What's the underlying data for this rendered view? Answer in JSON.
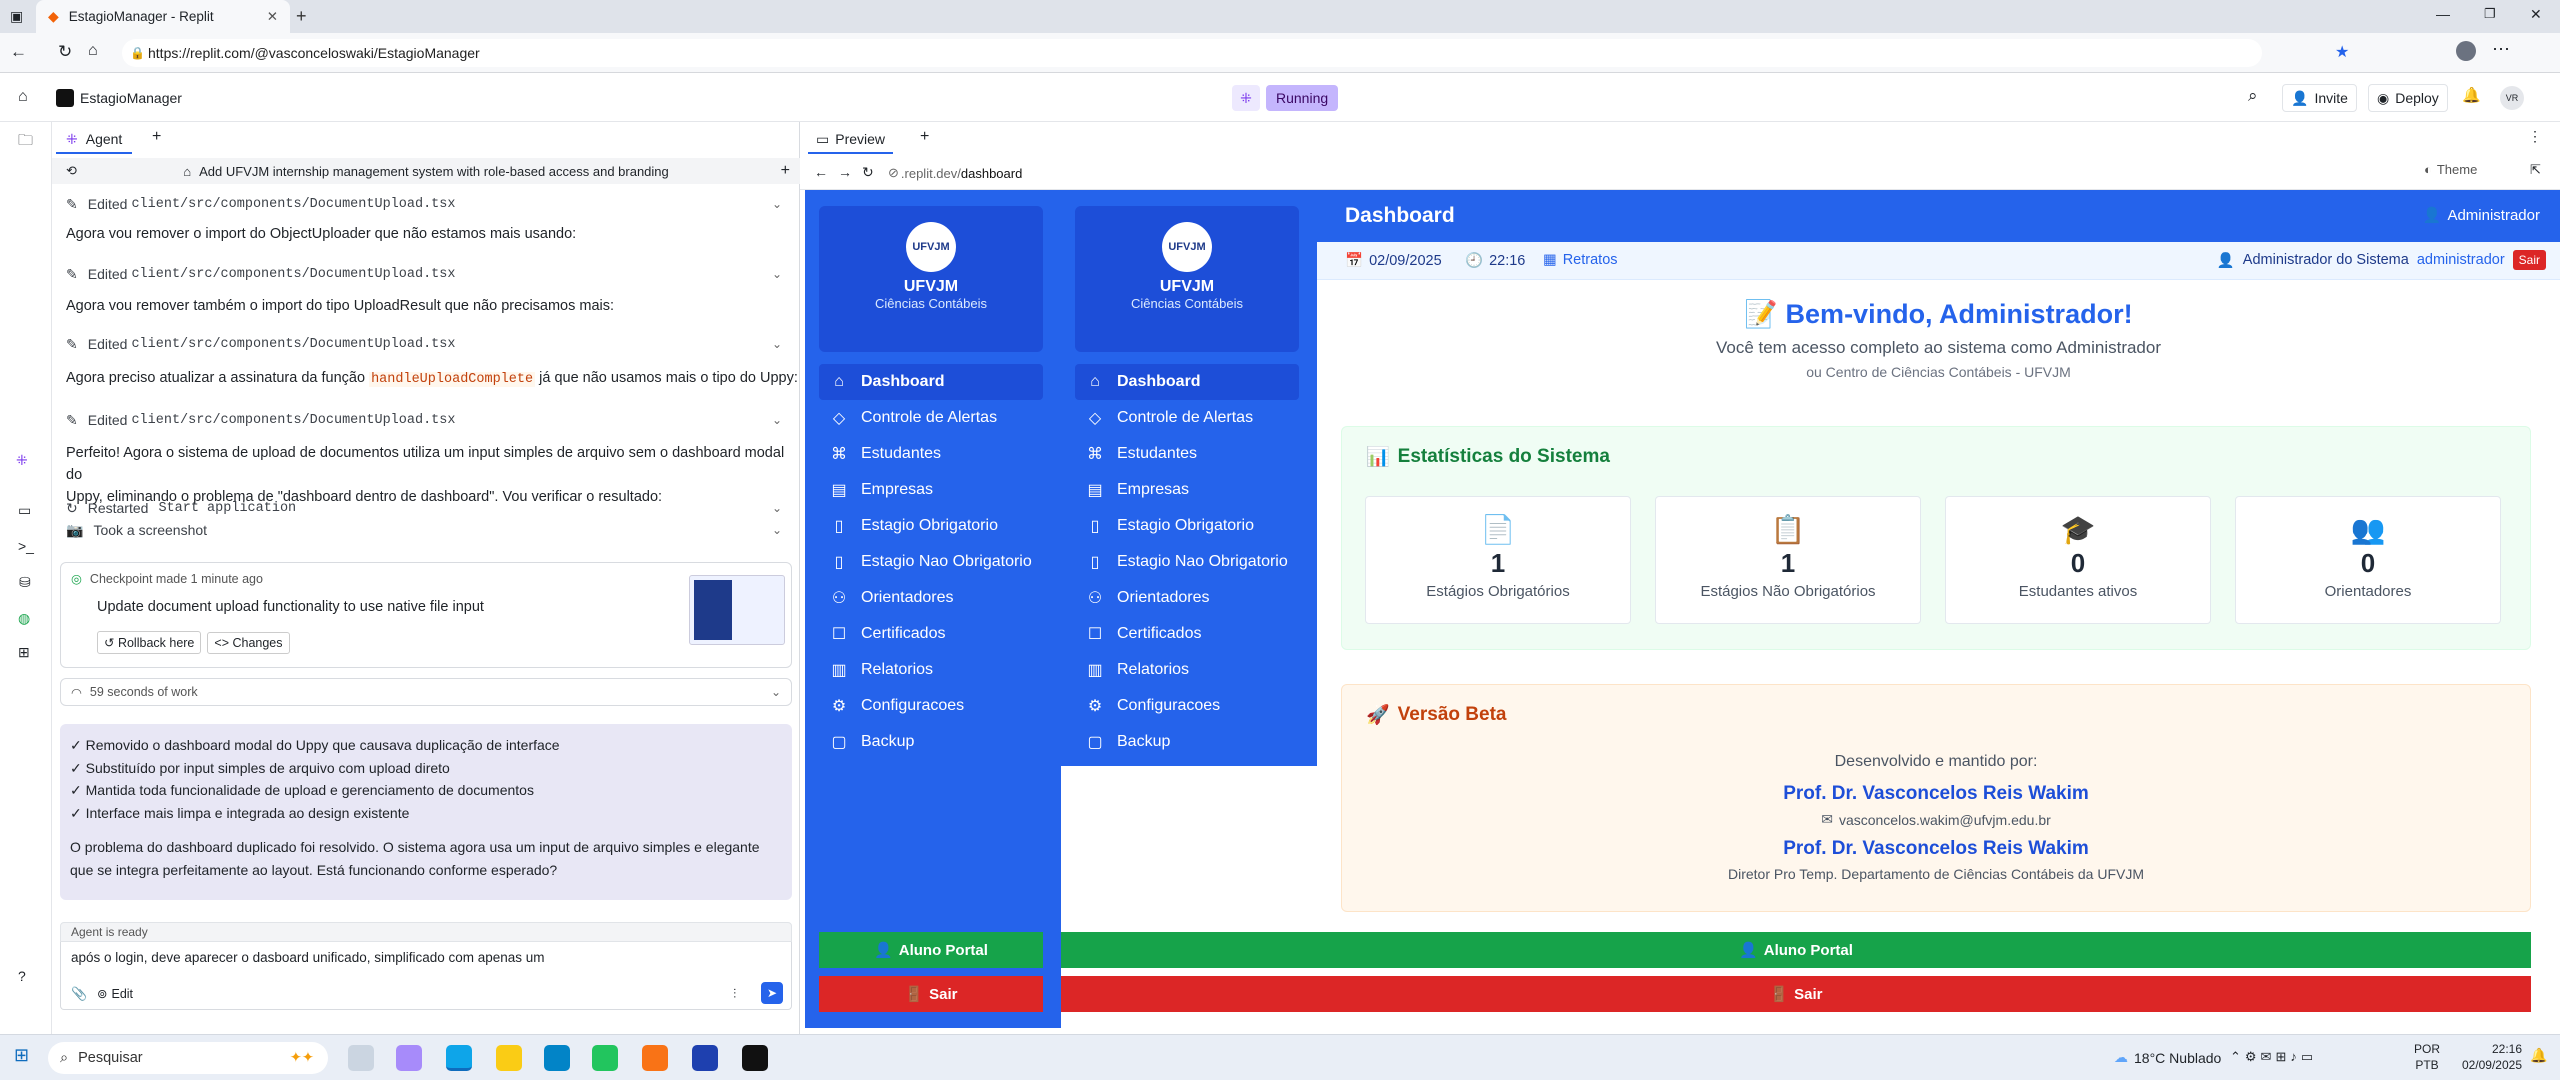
{
  "browser": {
    "tab_title": "EstagioManager - Replit",
    "url": "https://replit.com/@vasconceloswaki/EstagioManager"
  },
  "replit": {
    "project_name": "EstagioManager",
    "status": "Running",
    "invite_label": "Invite",
    "deploy_label": "Deploy",
    "avatar_initials": "VR"
  },
  "agent": {
    "tab_label": "Agent",
    "task_title": "Add UFVJM internship management system with role-based access and branding",
    "entries": [
      {
        "type": "edited",
        "label": "Edited",
        "file": "client/src/components/DocumentUpload.tsx"
      },
      {
        "type": "text",
        "text": "Agora vou remover o import do ObjectUploader que não estamos mais usando:"
      },
      {
        "type": "edited",
        "label": "Edited",
        "file": "client/src/components/DocumentUpload.tsx"
      },
      {
        "type": "text",
        "text": "Agora vou remover também o import do tipo UploadResult que não precisamos mais:"
      },
      {
        "type": "edited",
        "label": "Edited",
        "file": "client/src/components/DocumentUpload.tsx"
      },
      {
        "type": "text_code",
        "before": "Agora preciso atualizar a assinatura da função ",
        "code": "handleUploadComplete",
        "after": " já que não usamos mais o tipo do Uppy:"
      },
      {
        "type": "edited",
        "label": "Edited",
        "file": "client/src/components/DocumentUpload.tsx"
      }
    ],
    "summary_line1": "Perfeito! Agora o sistema de upload de documentos utiliza um input simples de arquivo sem o dashboard modal do",
    "summary_line2": "Uppy, eliminando o problema de \"dashboard dentro de dashboard\". Vou verificar o resultado:",
    "restarted_label": "Restarted",
    "restarted_code": "Start application",
    "screenshot_label": "Took a screenshot",
    "checkpoint_time": "Checkpoint made 1 minute ago",
    "checkpoint_desc": "Update document upload functionality to use native file input",
    "rollback_label": "Rollback here",
    "changes_label": "Changes",
    "work_time": "59 seconds of work",
    "bullets": [
      "✓ Removido o dashboard modal do Uppy que causava duplicação de interface",
      "✓ Substituído por input simples de arquivo com upload direto",
      "✓ Mantida toda funcionalidade de upload e gerenciamento de documentos",
      "✓ Interface mais limpa e integrada ao design existente"
    ],
    "final_line1": "O problema do dashboard duplicado foi resolvido. O sistema agora usa um input de arquivo simples e elegante",
    "final_line2": "que se integra perfeitamente ao layout. Está funcionando conforme esperado?",
    "ready_label": "Agent is ready",
    "input_value": "após o login, deve aparecer o dasboard unificado, simplificado com apenas um",
    "edit_label": "Edit"
  },
  "preview": {
    "tab_label": "Preview",
    "url_host": ".replit.dev/",
    "url_path": "dashboard",
    "theme_label": "Theme"
  },
  "app": {
    "logo_text": "UFVJM",
    "org_name": "UFVJM",
    "org_sub": "Ciências Contábeis",
    "nav": [
      "Dashboard",
      "Controle de Alertas",
      "Estudantes",
      "Empresas",
      "Estagio Obrigatorio",
      "Estagio Nao Obrigatorio",
      "Orientadores",
      "Certificados",
      "Relatorios",
      "Configuracoes",
      "Backup"
    ],
    "header_title": "Dashboard",
    "header_user": "Administrador",
    "date": "02/09/2025",
    "time": "22:16",
    "retratos_label": "Retratos",
    "system_user": "Administrador do Sistema",
    "username": "administrador",
    "logout_label": "Sair",
    "welcome_title": "Bem-vindo, Administrador!",
    "welcome_sub": "Você tem acesso completo ao sistema como Administrador",
    "welcome_sub2": "ou Centro de Ciências Contábeis - UFVJM",
    "stats_title": "Estatísticas do Sistema",
    "stats": [
      {
        "value": "1",
        "label": "Estágios Obrigatórios",
        "icon": "📄"
      },
      {
        "value": "1",
        "label": "Estágios Não Obrigatórios",
        "icon": "📋"
      },
      {
        "value": "0",
        "label": "Estudantes ativos",
        "icon": "🎓"
      },
      {
        "value": "0",
        "label": "Orientadores",
        "icon": "👥"
      }
    ],
    "beta_title": "Versão Beta",
    "beta_dev": "Desenvolvido e mantido por:",
    "beta_name": "Prof. Dr. Vasconcelos Reis Wakim",
    "beta_email": "vasconcelos.wakim@ufvjm.edu.br",
    "beta_name2": "Prof. Dr. Vasconcelos Reis Wakim",
    "beta_role": "Diretor Pro Temp. Departamento de Ciências Contábeis da UFVJM",
    "portal_label": "Aluno Portal",
    "sair_label": "Sair"
  },
  "taskbar": {
    "search_placeholder": "Pesquisar",
    "weather": "18°C  Nublado",
    "lang1": "POR",
    "lang2": "PTB",
    "clock_time": "22:16",
    "clock_date": "02/09/2025"
  },
  "colors": {
    "app_blue": "#2563eb",
    "green": "#16a34a",
    "red": "#dc2626",
    "running_purple": "#c4b5fd"
  }
}
